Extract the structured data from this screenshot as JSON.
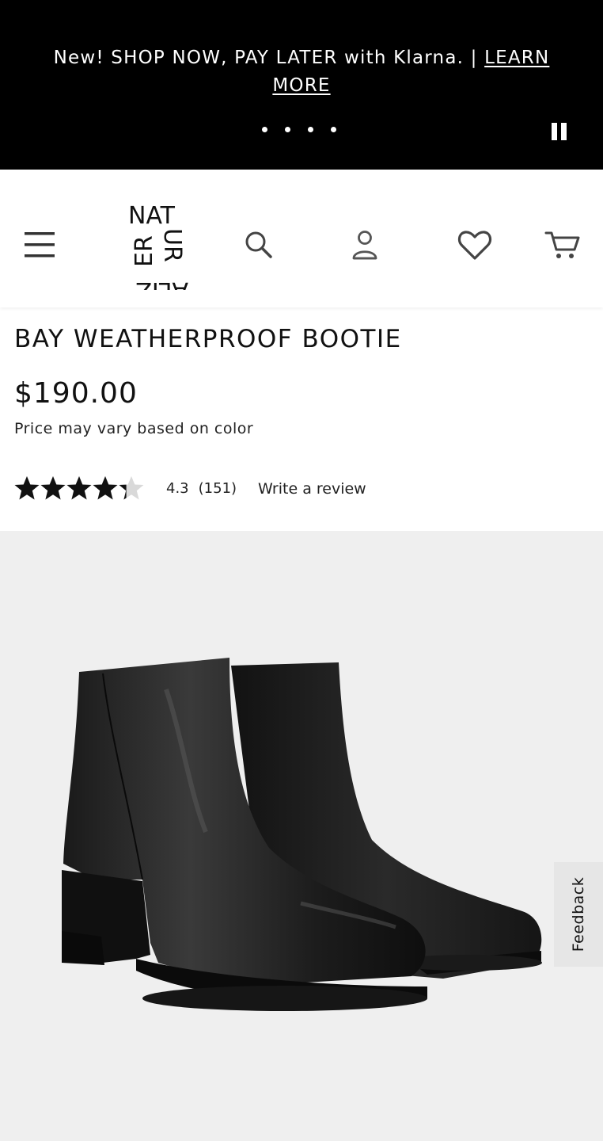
{
  "promo": {
    "text": "New! SHOP NOW, PAY LATER with Klarna. | ",
    "link": "LEARN MORE",
    "slide_count": 4,
    "pause_icon": "pause-icon"
  },
  "header": {
    "menu_icon": "hamburger-menu-icon",
    "logo": {
      "line1": "NAT",
      "line2": "UR",
      "line3": "ER",
      "line4": "ALIZ"
    },
    "search_icon": "search-icon",
    "account_icon": "user-icon",
    "wishlist_icon": "heart-icon",
    "cart_icon": "cart-icon"
  },
  "product": {
    "title": "BAY WEATHERPROOF BOOTIE",
    "price": "$190.00",
    "price_note": "Price may vary based on color",
    "rating": {
      "value": "4.3",
      "count": "(151)",
      "stars_out_of": 5,
      "stars_filled": 4.3,
      "write_review": "Write a review"
    },
    "image": "black-leather-ankle-boots"
  },
  "feedback": {
    "label": "Feedback"
  },
  "colors": {
    "banner_bg": "#000000",
    "image_bg": "#efefef",
    "feedback_bg": "#e6e6e6"
  }
}
